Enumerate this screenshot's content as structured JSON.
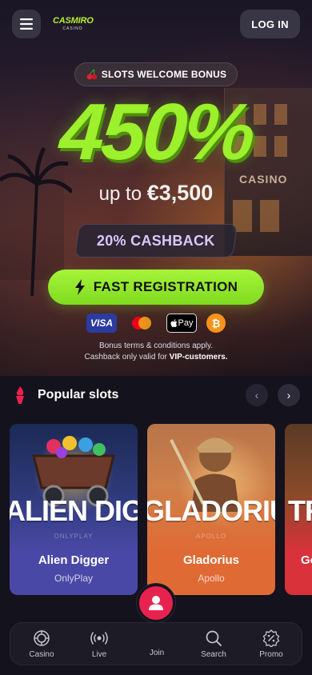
{
  "header": {
    "logo_name": "CASMIRO",
    "logo_sub": "CASINO",
    "login_label": "LOG IN"
  },
  "hero": {
    "bonus_label": "SLOTS WELCOME BONUS",
    "percent": "450%",
    "upto_prefix": "up to",
    "upto_amount": "€3,500",
    "cashback": "20% CASHBACK",
    "register_label": "FAST REGISTRATION",
    "background_sign": "CASINO",
    "payments": {
      "visa": "VISA",
      "applepay": "Pay",
      "bitcoin": "₿"
    },
    "terms_line1": "Bonus terms & conditions apply.",
    "terms_line2_prefix": "Cashback only valid for",
    "terms_line2_bold": "VIP-customers."
  },
  "popular": {
    "title": "Popular slots",
    "prev_arrow": "‹",
    "next_arrow": "›",
    "cards": [
      {
        "banner": "ALIEN DIGGER",
        "name": "Alien Digger",
        "studio": "OnlyPlay",
        "studio_ghost": "ONLYPLAY"
      },
      {
        "banner": "GLADORIUS",
        "name": "Gladorius",
        "studio": "Apollo",
        "studio_ghost": "APOLLO"
      },
      {
        "banner": "TRE",
        "name": "Go",
        "studio": ""
      }
    ]
  },
  "bottom_nav": {
    "items": [
      {
        "label": "Casino",
        "icon": "casino-chip-icon"
      },
      {
        "label": "Live",
        "icon": "live-broadcast-icon"
      },
      {
        "label": "Join",
        "icon": "user-icon"
      },
      {
        "label": "Search",
        "icon": "search-icon"
      },
      {
        "label": "Promo",
        "icon": "promo-badge-icon"
      }
    ]
  },
  "colors": {
    "accent_green": "#9cf02c",
    "join_red": "#e8224e",
    "background": "#14121c"
  }
}
